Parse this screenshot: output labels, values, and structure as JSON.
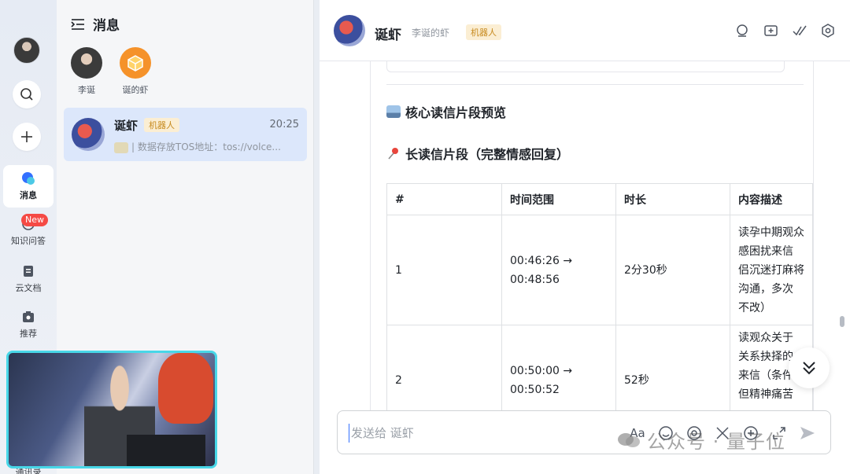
{
  "rail": {
    "items": [
      {
        "label": "消息"
      },
      {
        "label": "知识问答"
      },
      {
        "label": "云文档"
      },
      {
        "label": "推荐"
      },
      {
        "label": "通讯录"
      }
    ],
    "new_badge": "New"
  },
  "conv_panel": {
    "title": "消息",
    "pinned": [
      {
        "name": "李诞"
      },
      {
        "name": "诞的虾"
      }
    ],
    "conversation": {
      "name": "诞虾",
      "tag": "机器人",
      "time": "20:25",
      "preview": "| 数据存放TOS地址：tos://volce..."
    }
  },
  "chat": {
    "title": "诞虾",
    "subtitle": "李诞的虾",
    "tag": "机器人",
    "heading_preview": "核心读信片段预览",
    "heading_long": "长读信片段（完整情感回复）",
    "table": {
      "headers": [
        "#",
        "时间范围",
        "时长",
        "内容描述"
      ],
      "rows": [
        {
          "num": "1",
          "range_start": "00:46:26 →",
          "range_end": "00:48:56",
          "duration": "2分30秒",
          "desc": [
            "读孕中期观众",
            "感困扰来信",
            "侣沉迷打麻将",
            "沟通，多次",
            "不改）"
          ]
        },
        {
          "num": "2",
          "range_start": "00:50:00 →",
          "range_end": "00:50:52",
          "duration": "52秒",
          "desc": [
            "读观众关于",
            "关系抉择的",
            "来信（条件",
            "但精神痛苦"
          ]
        }
      ]
    },
    "input_placeholder": "发送给 诞虾",
    "input_tools": {
      "font": "Aa"
    }
  },
  "watermark": "公众号 · 量子位",
  "colors": {
    "accent": "#3370ff",
    "robot_tag_bg": "#fbeed3",
    "robot_tag_fg": "#c78a1e",
    "active_conv_bg": "#dce7fb",
    "new_badge": "#f54a45"
  }
}
